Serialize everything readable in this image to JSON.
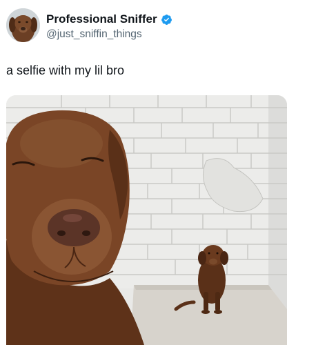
{
  "tweet": {
    "author": {
      "display_name": "Professional Sniffer",
      "handle": "@just_sniffin_things",
      "verified": true,
      "avatar_icon": "brown-dog-avatar"
    },
    "text": "a selfie with my lil bro",
    "media": {
      "type": "photo"
    }
  },
  "colors": {
    "verified_badge": "#1d9bf0",
    "handle_gray": "#536471",
    "text": "#0f1419"
  }
}
